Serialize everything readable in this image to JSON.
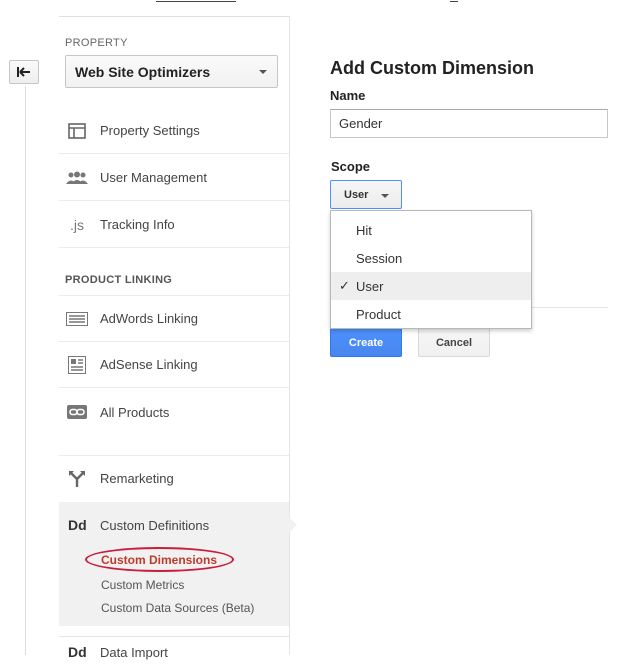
{
  "sidebar": {
    "property_label": "PROPERTY",
    "property_value": "Web Site Optimizers",
    "items_top": [
      {
        "label": "Property Settings",
        "icon": "layout-icon"
      },
      {
        "label": "User Management",
        "icon": "users-icon"
      },
      {
        "label": "Tracking Info",
        "icon": "js-icon"
      }
    ],
    "product_linking_label": "PRODUCT LINKING",
    "items_linking": [
      {
        "label": "AdWords Linking",
        "icon": "adwords-icon"
      },
      {
        "label": "AdSense Linking",
        "icon": "adsense-icon"
      },
      {
        "label": "All Products",
        "icon": "link-icon"
      }
    ],
    "remarketing": {
      "label": "Remarketing",
      "icon": "fork-icon"
    },
    "custom_definitions": {
      "icon_text": "Dd",
      "label": "Custom Definitions",
      "sub": [
        "Custom Dimensions",
        "Custom Metrics",
        "Custom Data Sources (Beta)"
      ]
    },
    "data_import": {
      "icon_text": "Dd",
      "label": "Data Import"
    }
  },
  "main": {
    "title": "Add Custom Dimension",
    "name_label": "Name",
    "name_value": "Gender",
    "scope_label": "Scope",
    "scope_value": "User",
    "scope_options": [
      "Hit",
      "Session",
      "User",
      "Product"
    ],
    "check_mark": "✓",
    "create_label": "Create",
    "cancel_label": "Cancel"
  },
  "colors": {
    "accent": "#4d90fe",
    "active_link": "#c0392b",
    "annotation": "#c81e3c"
  }
}
